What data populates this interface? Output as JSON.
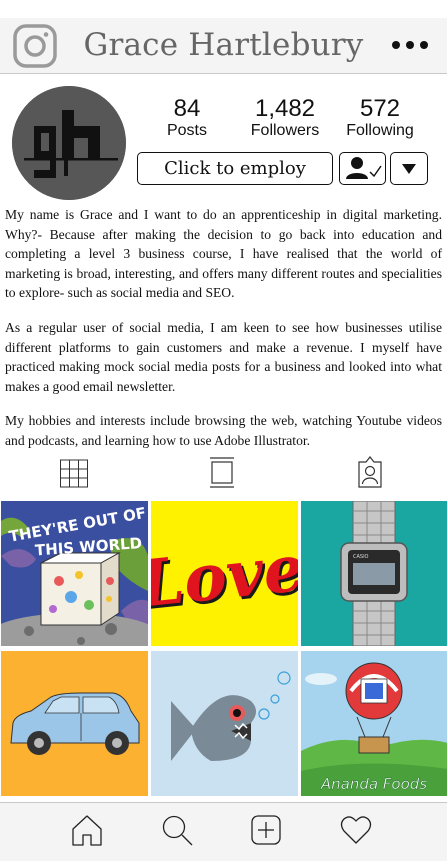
{
  "header": {
    "title": "Grace Hartlebury",
    "left_icon": "instagram-camera-icon",
    "right_icon": "more-options-icon"
  },
  "profile": {
    "avatar_logo": "gh",
    "stats": [
      {
        "value": "84",
        "label": "Posts"
      },
      {
        "value": "1,482",
        "label": "Followers"
      },
      {
        "value": "572",
        "label": "Following"
      }
    ],
    "employ_label": "Click to employ",
    "follow_icon": "following-user-check-icon",
    "dropdown_icon": "chevron-down-icon"
  },
  "bio": {
    "paragraphs": [
      "My name is Grace and I want to do an apprenticeship in digital marketing. Why?- Because after making the decision to go back into education and completing a level 3 business course, I have realised that the world of marketing is broad, interesting, and offers many different routes and specialities to explore- such as social media and SEO.",
      "As a regular user of social media, I am keen to see how businesses utilise different platforms to gain customers and make a revenue. I myself have practiced making mock social media posts for a business and looked into what makes a good email newsletter.",
      "My hobbies and interests include browsing the web, watching Youtube videos and podcasts, and learning how to use Adobe Illustrator."
    ]
  },
  "tabs": [
    "grid-icon",
    "feed-icon",
    "tagged-icon"
  ],
  "posts": [
    {
      "name": "post-out-of-this-world",
      "text": "THEY'RE OUT OF THIS WORLD",
      "bg": "#3a4fa0"
    },
    {
      "name": "post-love",
      "text": "Love",
      "bg": "#fef200"
    },
    {
      "name": "post-watch",
      "text": "CASIO",
      "bg": "#1aa6a1"
    },
    {
      "name": "post-car",
      "text": "",
      "bg": "#fcb131"
    },
    {
      "name": "post-fish",
      "text": "",
      "bg": "#c9e1f1"
    },
    {
      "name": "post-ananda-foods",
      "text": "Ananda Foods",
      "bg": "#5fb846"
    }
  ],
  "colors": {
    "header_bg": "#f4f4f4",
    "title_text": "#666666",
    "border": "#111111"
  },
  "bottom_nav": [
    "home-icon",
    "search-icon",
    "add-post-icon",
    "heart-icon"
  ]
}
